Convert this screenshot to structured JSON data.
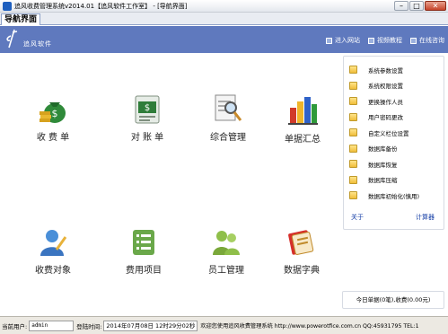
{
  "window": {
    "title": "追风收费管理系统v2014.01【追风软件工作室】 - [导航界面]",
    "controls": {
      "minimize": "–",
      "maximize": "□",
      "close": "✕"
    }
  },
  "tabs": [
    {
      "label": "导航界面"
    }
  ],
  "banner": {
    "logo_text": "追风软件",
    "links": [
      {
        "label": "进入网站",
        "icon": "square-icon"
      },
      {
        "label": "视频教程",
        "icon": "square-icon"
      },
      {
        "label": "在线咨询",
        "icon": "square-icon"
      }
    ]
  },
  "tiles": [
    {
      "label": "收 费 单",
      "icon": "money-bag-icon"
    },
    {
      "label": "对 账 单",
      "icon": "bill-icon"
    },
    {
      "label": "综合管理",
      "icon": "magnifier-document-icon"
    },
    {
      "label": "单据汇总",
      "icon": "bar-chart-icon"
    },
    {
      "label": "收费对象",
      "icon": "user-icon"
    },
    {
      "label": "费用项目",
      "icon": "list-icon"
    },
    {
      "label": "员工管理",
      "icon": "people-icon"
    },
    {
      "label": "数据字典",
      "icon": "book-icon"
    }
  ],
  "side_panel": {
    "items": [
      "系统参数设置",
      "系统权限设置",
      "更换操作人员",
      "用户密码更改",
      "自定义栏位设置",
      "数据库备份",
      "数据库恢复",
      "数据库压缩",
      "数据库初始化(慎用)"
    ],
    "about_label": "关于",
    "calculator_label": "计算器"
  },
  "today_summary": "今日单据(0笔),收费(0.00元)",
  "status": {
    "user_label": "当前用户:",
    "user_value": "admin",
    "login_label": "登陆时间:",
    "login_value": "2014年07月08日 12时29分02秒",
    "message": "欢迎您使用追风收费管理系统 http://www.powerotfice.com.cn QQ:45931795 TEL:1"
  }
}
